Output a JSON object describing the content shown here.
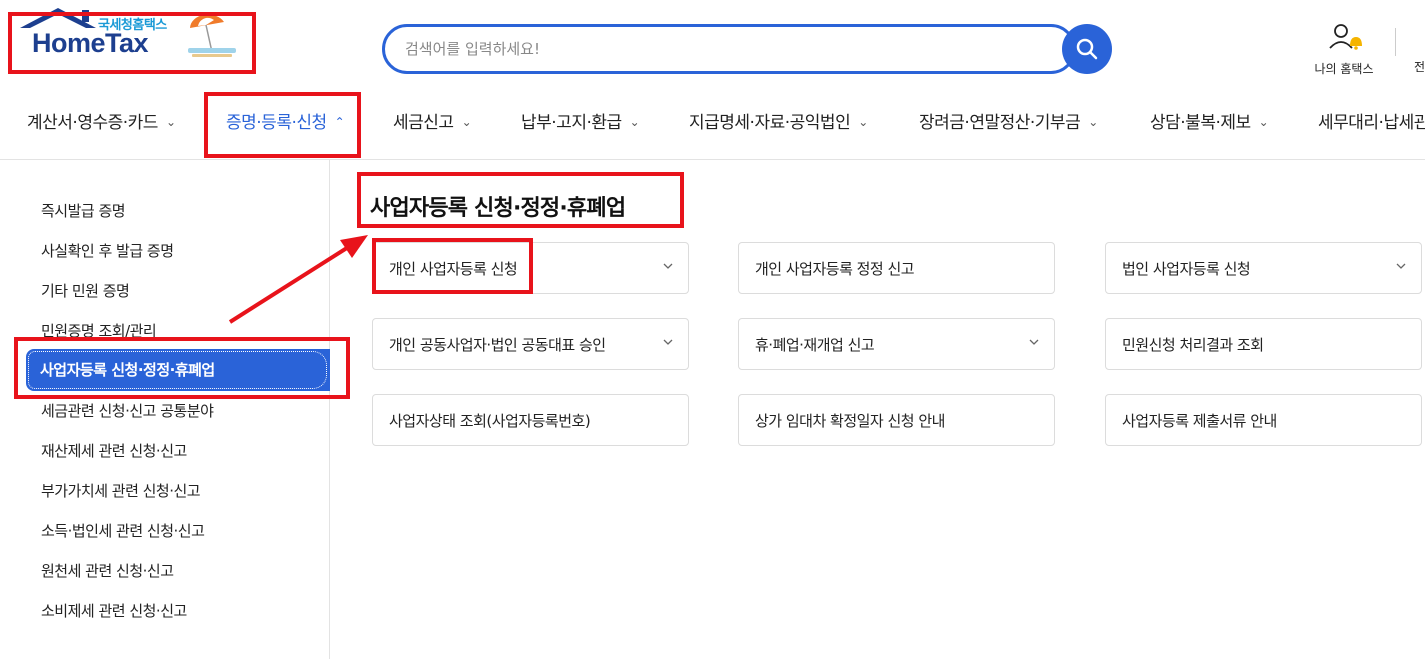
{
  "logo": {
    "sub": "국세청홈택스",
    "main": "HomeTax"
  },
  "search": {
    "placeholder": "검색어를 입력하세요!"
  },
  "header": {
    "my_hometax": "나의 홈택스",
    "cut_label": "전"
  },
  "nav": {
    "items": [
      {
        "label": "계산서·영수증·카드"
      },
      {
        "label": "증명·등록·신청"
      },
      {
        "label": "세금신고"
      },
      {
        "label": "납부·고지·환급"
      },
      {
        "label": "지급명세·자료·공익법인"
      },
      {
        "label": "장려금·연말정산·기부금"
      },
      {
        "label": "상담·불복·제보"
      },
      {
        "label": "세무대리·납세관"
      }
    ]
  },
  "sidebar": {
    "items": [
      {
        "label": "즉시발급 증명"
      },
      {
        "label": "사실확인 후 발급 증명"
      },
      {
        "label": "기타 민원 증명"
      },
      {
        "label": "민원증명 조회/관리"
      },
      {
        "label": "사업자등록 신청·정정·휴폐업"
      },
      {
        "label": "세금관련 신청·신고 공통분야"
      },
      {
        "label": "재산제세 관련 신청·신고"
      },
      {
        "label": "부가가치세 관련 신청·신고"
      },
      {
        "label": "소득·법인세 관련 신청·신고"
      },
      {
        "label": "원천세 관련 신청·신고"
      },
      {
        "label": "소비제세 관련 신청·신고"
      }
    ]
  },
  "content": {
    "title": "사업자등록 신청·정정·휴폐업",
    "cards": [
      {
        "label": "개인 사업자등록 신청",
        "chevron": true
      },
      {
        "label": "개인 사업자등록 정정 신고",
        "chevron": false
      },
      {
        "label": "법인 사업자등록 신청",
        "chevron": true
      },
      {
        "label": "개인 공동사업자·법인 공동대표 승인",
        "chevron": true
      },
      {
        "label": "휴·폐업·재개업 신고",
        "chevron": true
      },
      {
        "label": "민원신청 처리결과 조회",
        "chevron": false
      },
      {
        "label": "사업자상태 조회(사업자등록번호)",
        "chevron": false
      },
      {
        "label": "상가 임대차 확정일자 신청 안내",
        "chevron": false
      },
      {
        "label": "사업자등록 제출서류 안내",
        "chevron": false
      }
    ]
  },
  "colors": {
    "accent": "#2a63d8",
    "highlight": "#e8131b"
  }
}
